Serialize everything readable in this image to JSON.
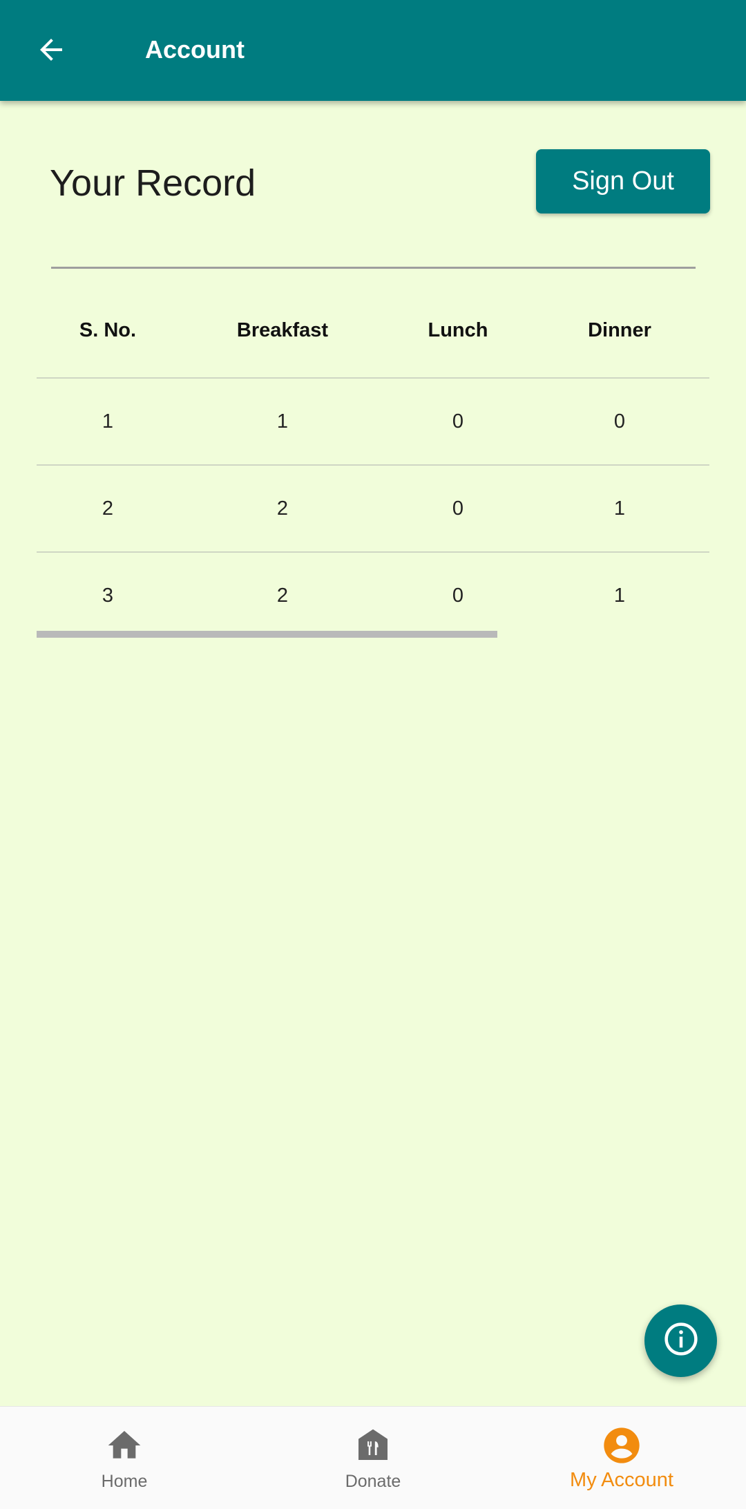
{
  "app_bar": {
    "title": "Account",
    "back_icon": "arrow-back-icon"
  },
  "header": {
    "title": "Your Record",
    "sign_out_label": "Sign Out"
  },
  "table": {
    "columns": [
      "S. No.",
      "Breakfast",
      "Lunch",
      "Dinner"
    ],
    "rows": [
      [
        "1",
        "1",
        "0",
        "0"
      ],
      [
        "2",
        "2",
        "0",
        "1"
      ],
      [
        "3",
        "2",
        "0",
        "1"
      ]
    ]
  },
  "fab": {
    "icon": "info-icon"
  },
  "bottom_nav": {
    "items": [
      {
        "label": "Home",
        "icon": "home-icon",
        "active": false
      },
      {
        "label": "Donate",
        "icon": "donate-icon",
        "active": false
      },
      {
        "label": "My Account",
        "icon": "account-circle-icon",
        "active": true
      }
    ]
  },
  "colors": {
    "primary": "#007c80",
    "background": "#f1fdda",
    "accent": "#f28c0f",
    "inactive_nav": "#6b6b6b"
  }
}
